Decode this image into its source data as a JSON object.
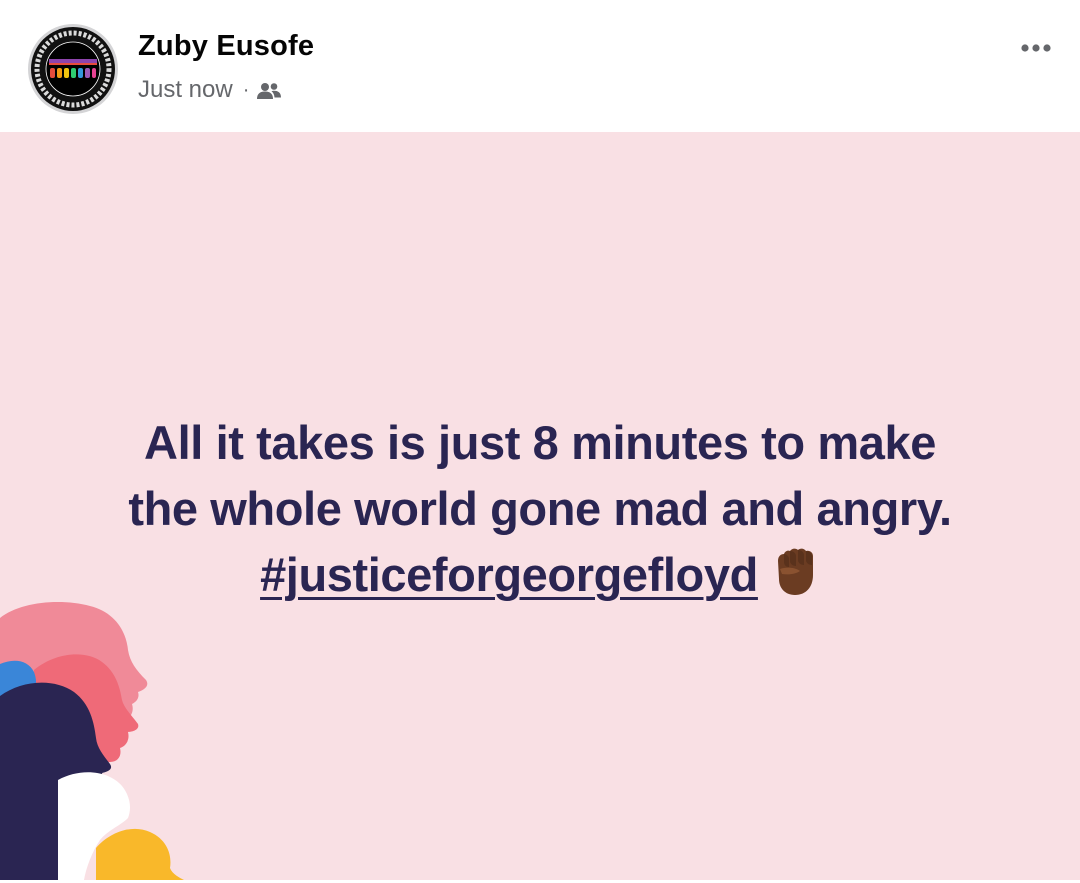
{
  "post": {
    "author_name": "Zuby Eusofe",
    "timestamp": "Just now",
    "separator": "·",
    "audience_icon": "friends-icon",
    "more_icon": "more-options-icon",
    "avatar_badge": "black-lives-matter-badge",
    "avatar_badge_text": "BLACK LIVES MATTER",
    "avatar_badge_center_text": "TOGETHER WE RISE"
  },
  "content": {
    "line1": "All it takes is just 8 minutes to make",
    "line2": "the whole world gone mad and angry.",
    "hashtag": "#justiceforgeorgefloyd",
    "emoji": "raised-fist-emoji"
  },
  "colors": {
    "background": "#f9e0e4",
    "text": "#2a2552",
    "secondary_text": "#65676b",
    "silhouette_pink": "#f08a98",
    "silhouette_red": "#ef6a78",
    "silhouette_blue": "#3a86d8",
    "silhouette_navy": "#2a2552",
    "silhouette_yellow": "#f9b82a"
  }
}
